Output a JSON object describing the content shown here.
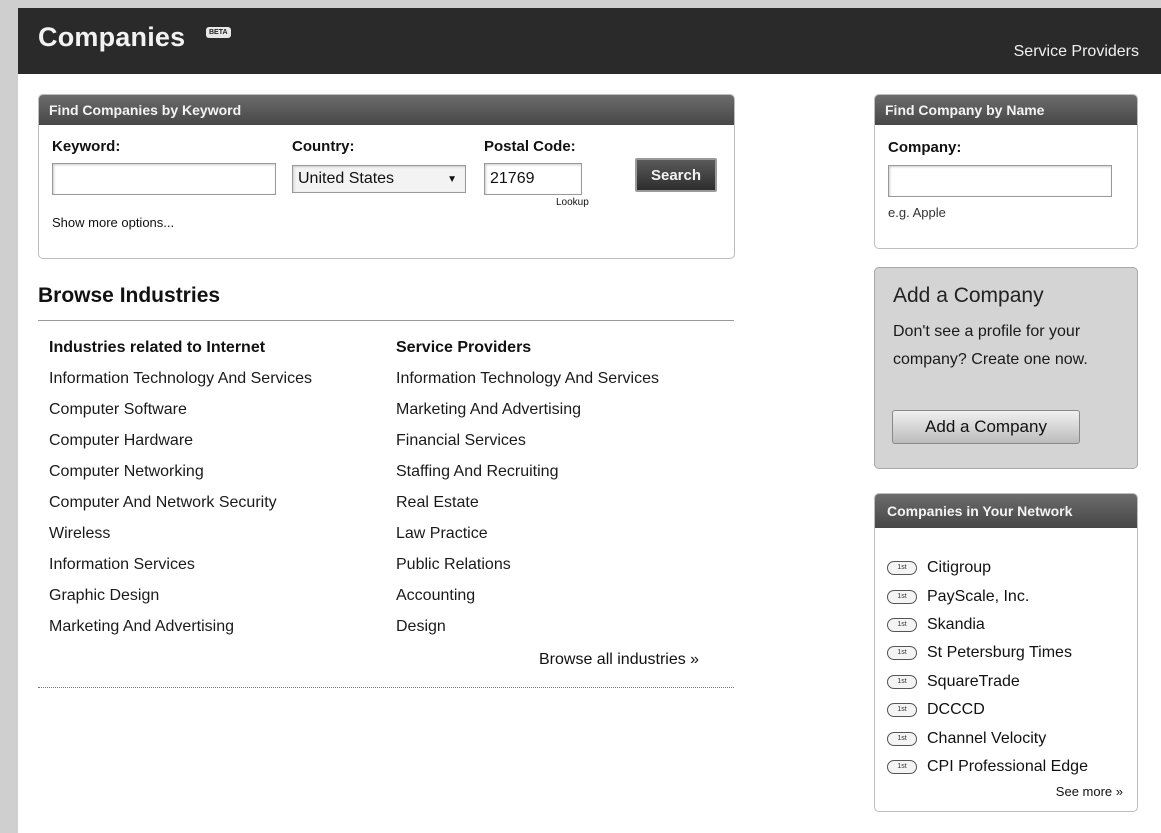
{
  "header": {
    "title": "Companies",
    "beta_badge": "BETA",
    "service_providers_link": "Service Providers"
  },
  "keyword_search": {
    "heading": "Find Companies by Keyword",
    "keyword_label": "Keyword:",
    "keyword_value": "",
    "country_label": "Country:",
    "country_value": "United States",
    "postal_label": "Postal Code:",
    "postal_value": "21769",
    "lookup_link": "Lookup",
    "search_button": "Search",
    "more_options": "Show more options..."
  },
  "browse": {
    "title": "Browse Industries",
    "left_heading": "Industries related to Internet",
    "left_items": [
      "Information Technology And Services",
      "Computer Software",
      "Computer Hardware",
      "Computer Networking",
      "Computer And Network Security",
      "Wireless",
      "Information Services",
      "Graphic Design",
      "Marketing And Advertising"
    ],
    "right_heading": "Service Providers",
    "right_items": [
      "Information Technology And Services",
      "Marketing And Advertising",
      "Financial Services",
      "Staffing And Recruiting",
      "Real Estate",
      "Law Practice",
      "Public Relations",
      "Accounting",
      "Design"
    ],
    "browse_all": "Browse all industries »"
  },
  "name_search": {
    "heading": "Find Company by Name",
    "company_label": "Company:",
    "company_value": "",
    "example": "e.g. Apple"
  },
  "add_company": {
    "title": "Add a Company",
    "text": "Don't see a profile for your company? Create one now.",
    "button": "Add a Company"
  },
  "network": {
    "heading": "Companies in Your Network",
    "badge": "1st",
    "items": [
      "Citigroup",
      "PayScale, Inc.",
      "Skandia",
      "St Petersburg Times",
      "SquareTrade",
      "DCCCD",
      "Channel Velocity",
      "CPI Professional Edge"
    ],
    "see_more": "See more »"
  }
}
